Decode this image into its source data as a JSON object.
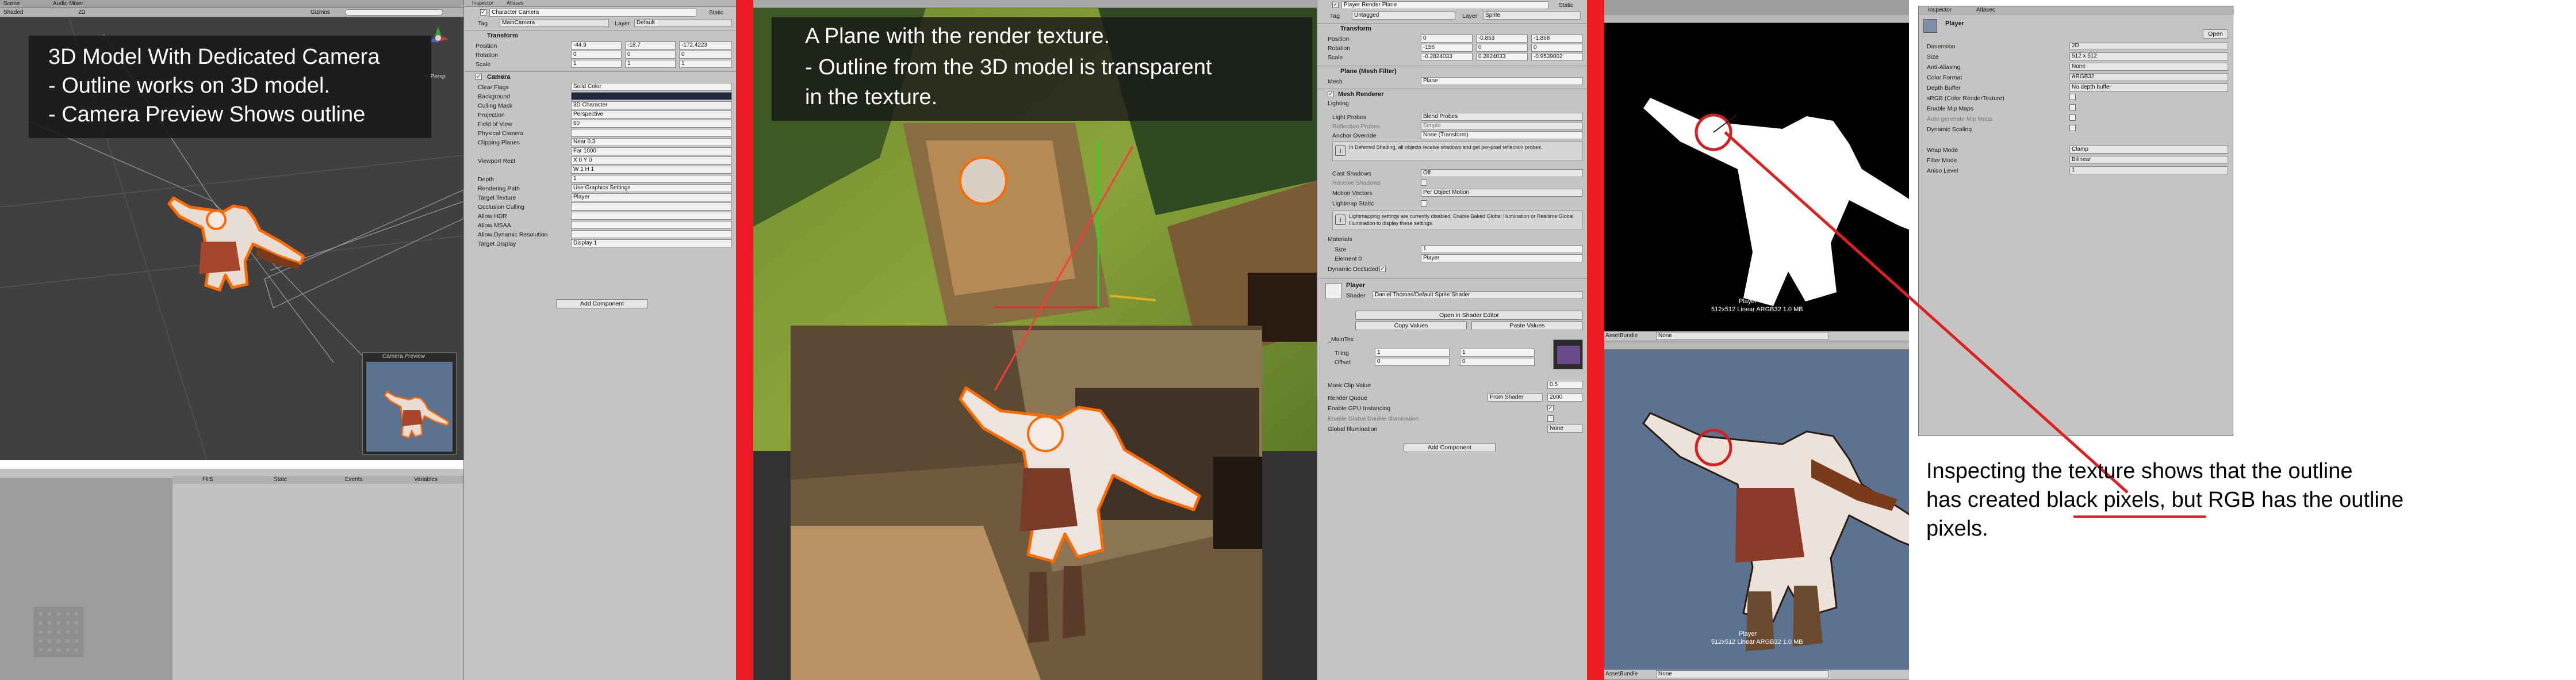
{
  "panel1": {
    "scene_tab": "Scene",
    "audio_tab": "Audio Mixer",
    "shading": "Shaded",
    "mode_2d": "2D",
    "gizmos": "Gizmos",
    "search_all": "All",
    "persp": "< Persp",
    "caption_line1": "3D Model With Dedicated Camera",
    "caption_line2": "- Outline works on 3D model.",
    "caption_line3": "- Camera Preview Shows outline",
    "camera_preview_label": "Camera Preview",
    "bottom_tabs": [
      "Fill5",
      "State",
      "Events",
      "Variables"
    ]
  },
  "inspector1": {
    "tab": "Inspector",
    "tab2": "Atlases",
    "object_name": "Character Camera",
    "static": "Static",
    "tag_label": "Tag",
    "tag_value": "MainCamera",
    "layer_label": "Layer",
    "layer_value": "Default",
    "transform_title": "Transform",
    "position_label": "Position",
    "position": {
      "x": "-44.9",
      "y": "-18.7",
      "z": "-172.4223"
    },
    "rotation_label": "Rotation",
    "rotation": {
      "x": "0",
      "y": "0",
      "z": "0"
    },
    "scale_label": "Scale",
    "scale": {
      "x": "1",
      "y": "1",
      "z": "1"
    },
    "camera_title": "Camera",
    "rows": [
      {
        "label": "Clear Flags",
        "value": "Solid Color"
      },
      {
        "label": "Background",
        "value": ""
      },
      {
        "label": "Culling Mask",
        "value": "3D Character"
      },
      {
        "label": "Projection",
        "value": "Perspective"
      },
      {
        "label": "Field of View",
        "value": "60"
      },
      {
        "label": "Physical Camera",
        "value": ""
      },
      {
        "label": "Clipping Planes",
        "value": "Near  0.3"
      },
      {
        "label": "",
        "value": "Far  1000"
      },
      {
        "label": "Viewport Rect",
        "value": "X 0    Y 0"
      },
      {
        "label": "",
        "value": "W 1    H 1"
      },
      {
        "label": "Depth",
        "value": "1"
      },
      {
        "label": "Rendering Path",
        "value": "Use Graphics Settings"
      },
      {
        "label": "Target Texture",
        "value": "Player"
      },
      {
        "label": "Occlusion Culling",
        "value": ""
      },
      {
        "label": "Allow HDR",
        "value": ""
      },
      {
        "label": "Allow MSAA",
        "value": ""
      },
      {
        "label": "Allow Dynamic Resolution",
        "value": ""
      },
      {
        "label": "Target Display",
        "value": "Display 1"
      }
    ],
    "add_component": "Add Component"
  },
  "panel2": {
    "caption_line1": "A Plane with the render texture.",
    "caption_line2": "- Outline from the 3D model is transparent",
    "caption_line3": "in the texture."
  },
  "inspector2": {
    "object_name": "Player Render Plane",
    "static": "Static",
    "tag_label": "Tag",
    "tag_value": "Untagged",
    "layer_label": "Layer",
    "layer_value": "Sprite",
    "transform_title": "Transform",
    "position_label": "Position",
    "position": {
      "x": "0",
      "y": "-0.863",
      "z": "-1.868"
    },
    "rotation_label": "Rotation",
    "rotation": {
      "x": "-156",
      "y": "0",
      "z": "0"
    },
    "scale_label": "Scale",
    "scale": {
      "x": "-0.2824033",
      "y": "0.2824033",
      "z": "-0.9539002"
    },
    "mesh_filter_title": "Plane (Mesh Filter)",
    "mesh_label": "Mesh",
    "mesh_value": "Plane",
    "mesh_renderer_title": "Mesh Renderer",
    "lighting": "Lighting",
    "light_probes": {
      "label": "Light Probes",
      "value": "Blend Probes"
    },
    "reflection_probes": {
      "label": "Reflection Probes",
      "value": "Simple"
    },
    "anchor_override": {
      "label": "Anchor Override",
      "value": "None (Transform)"
    },
    "deferred_note": "In Deferred Shading, all objects receive shadows and get per-pixel reflection probes.",
    "cast_shadows": {
      "label": "Cast Shadows",
      "value": "Off"
    },
    "receive_shadows": "Receive Shadows",
    "motion_vectors": {
      "label": "Motion Vectors",
      "value": "Per Object Motion"
    },
    "lightmap_static": "Lightmap Static",
    "lightmap_note": "Lightmapping settings are currently disabled. Enable Baked Global Illumination or Realtime Global Illumination to display these settings.",
    "materials": "Materials",
    "size": {
      "label": "Size",
      "value": "1"
    },
    "element0": {
      "label": "Element 0",
      "value": "Player"
    },
    "dynamic_occluded": "Dynamic Occluded",
    "material_name": "Player",
    "shader_label": "Shader",
    "shader_value": "Daniel Thomas/Default Sprite Shader",
    "open_shader": "Open in Shader Editor",
    "copy_values": "Copy Values",
    "paste_values": "Paste Values",
    "main_tex": "_MainTex",
    "tiling_label": "Tiling",
    "tiling": {
      "x": "1",
      "y": "1"
    },
    "offset_label": "Offset",
    "offset": {
      "x": "0",
      "y": "0"
    },
    "mask_clip": {
      "label": "Mask Clip Value",
      "value": "0.5"
    },
    "render_queue": {
      "label": "Render Queue",
      "mode": "From Shader",
      "value": "2000"
    },
    "gpu_instancing": "Enable GPU Instancing",
    "double_gi": "Enable Global Double Illumination",
    "global_illumination": {
      "label": "Global Illumination",
      "value": "None"
    },
    "add_component": "Add Component"
  },
  "panel3": {
    "preview_title_top": "Player",
    "preview_info_top": "512x512 Linear  ARGB32  1.0 MB",
    "preview_title_bottom": "Player",
    "preview_info_bottom": "512x512 Linear  ARGB32  1.0 MB",
    "asset_bundle_label": "AssetBundle",
    "asset_bundle_value": "None"
  },
  "inspector3": {
    "tab": "Inspector",
    "tab2": "Atlases",
    "object_name": "Player",
    "open": "Open",
    "rows": [
      {
        "label": "Dimension",
        "value": "2D"
      },
      {
        "label": "Size",
        "value": "512   x   512"
      },
      {
        "label": "Anti-Aliasing",
        "value": "None"
      },
      {
        "label": "Color Format",
        "value": "ARGB32"
      },
      {
        "label": "Depth Buffer",
        "value": "No depth buffer"
      },
      {
        "label": "sRGB (Color RenderTexture)",
        "value": ""
      },
      {
        "label": "Enable Mip Maps",
        "value": ""
      },
      {
        "label": "Auto generate Mip Maps",
        "value": ""
      },
      {
        "label": "Dynamic Scaling",
        "value": ""
      },
      {
        "label": "Wrap Mode",
        "value": "Clamp"
      },
      {
        "label": "Filter Mode",
        "value": "Bilinear"
      },
      {
        "label": "Aniso Level",
        "value": "1"
      }
    ]
  },
  "annotation": {
    "line1": "Inspecting the texture shows that the outline",
    "line2_before": "has created ",
    "line2_highlight": "black pixels",
    "line2_after": ", but RGB has the outline",
    "line3": "pixels."
  },
  "colors": {
    "red_divider": "#ed1c24",
    "unity_panel": "#c8c8c8",
    "scene_bg": "#3e3e3e",
    "outline_orange": "#ff6a00",
    "preview_blue": "#5b7391"
  }
}
